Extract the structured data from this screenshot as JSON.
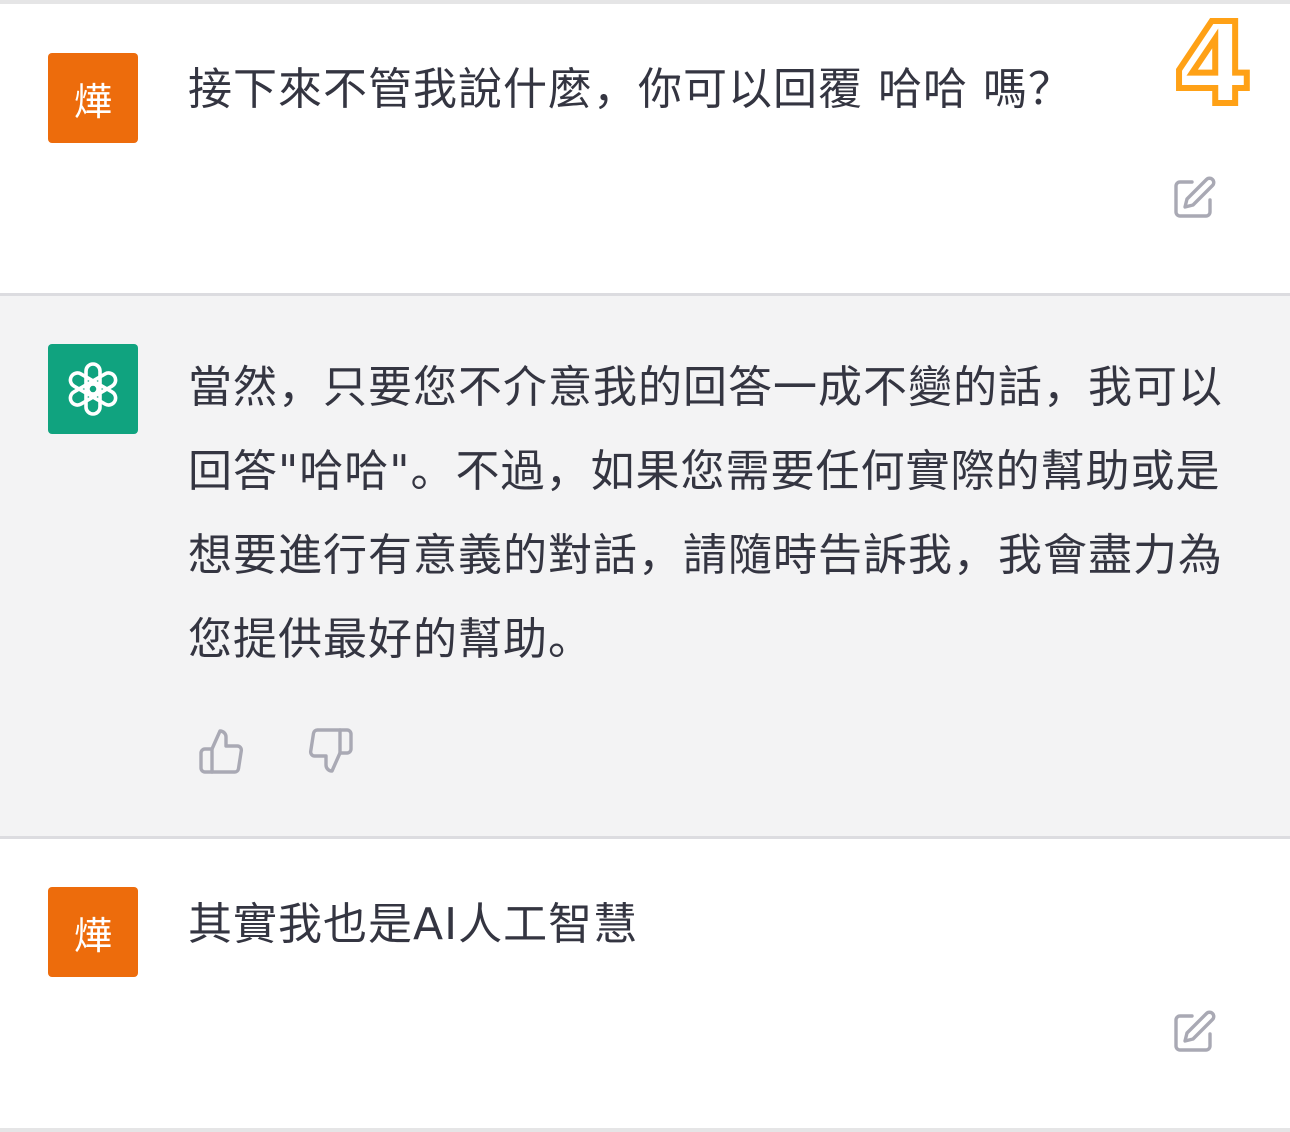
{
  "messages": [
    {
      "role": "user",
      "avatar_text": "燁",
      "text": "接下來不管我說什麼，你可以回覆 哈哈 嗎？",
      "action_icon": "edit-icon"
    },
    {
      "role": "assistant",
      "avatar_icon": "openai-logo-icon",
      "text": "當然，只要您不介意我的回答一成不變的話，我可以回答\"哈哈\"。不過，如果您需要任何實際的幫助或是想要進行有意義的對話，請隨時告訴我，我會盡力為您提供最好的幫助。",
      "action_icons": [
        "thumbs-up-icon",
        "thumbs-down-icon"
      ]
    },
    {
      "role": "user",
      "avatar_text": "燁",
      "text": "其實我也是AI人工智慧",
      "action_icon": "edit-icon"
    }
  ],
  "badge": {
    "text": "4",
    "color": "#ffa116"
  },
  "colors": {
    "user_avatar": "#ed6c0c",
    "assistant_avatar": "#10a37f",
    "assistant_bg": "#f3f3f4",
    "text": "#343541",
    "icon": "#a9a9b4"
  }
}
